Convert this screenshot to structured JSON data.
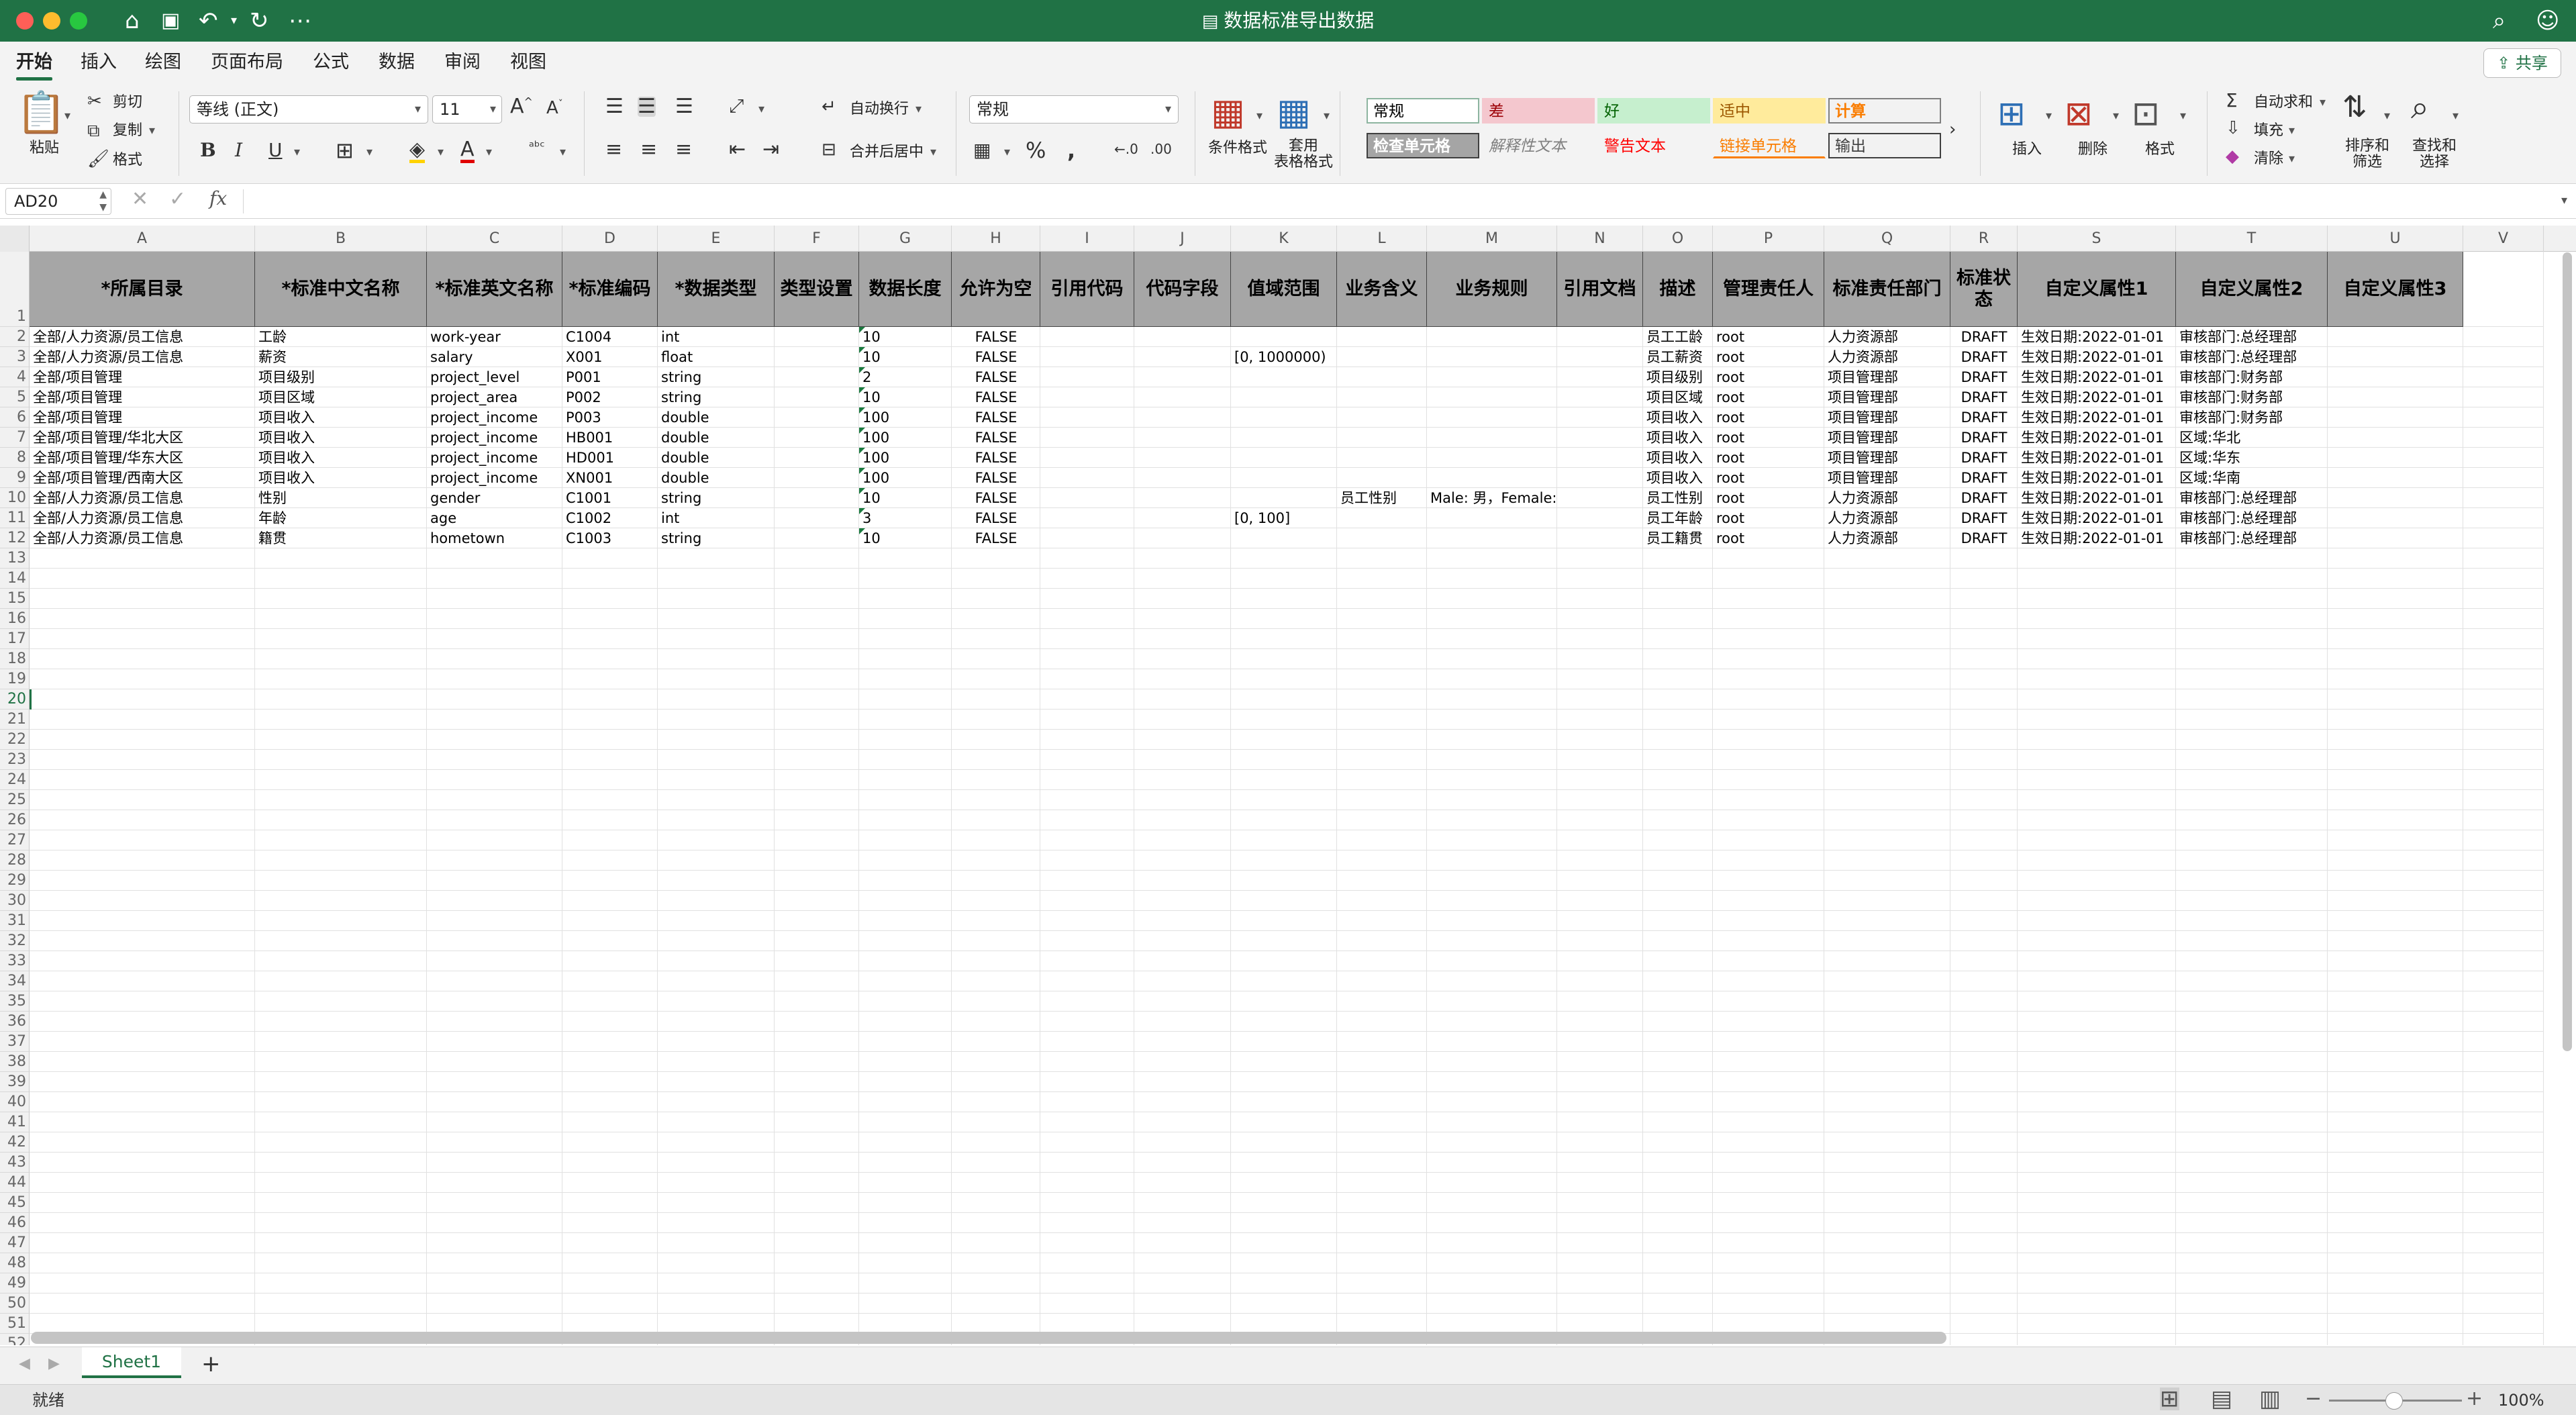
{
  "window": {
    "title": "数据标准导出数据",
    "title_icon": "document-icon"
  },
  "menu_tabs": [
    "开始",
    "插入",
    "绘图",
    "页面布局",
    "公式",
    "数据",
    "审阅",
    "视图"
  ],
  "share_label": "共享",
  "ribbon": {
    "paste": "粘贴",
    "cut": "剪切",
    "copy": "复制",
    "format_painter": "格式",
    "font_name": "等线 (正文)",
    "font_size": "11",
    "wrap_text": "自动换行",
    "merge_center": "合并后居中",
    "number_format": "常规",
    "conditional_format": "条件格式",
    "table_format": "套用\n表格格式",
    "styles": [
      {
        "label": "常规",
        "bg": "#ffffff",
        "fg": "#000000",
        "border": "#8db5a0"
      },
      {
        "label": "差",
        "bg": "#f4c7ce",
        "fg": "#9c0006",
        "border": "#f4c7ce"
      },
      {
        "label": "好",
        "bg": "#c6efce",
        "fg": "#006100",
        "border": "#c6efce"
      },
      {
        "label": "适中",
        "bg": "#ffeb9c",
        "fg": "#9c5700",
        "border": "#ffeb9c"
      },
      {
        "label": "计算",
        "bg": "#f2f2f2",
        "fg": "#fa7d00",
        "border": "#7f7f7f"
      },
      {
        "label": "检查单元格",
        "bg": "#a5a5a5",
        "fg": "#ffffff",
        "border": "#3f3f3f"
      },
      {
        "label": "解释性文本",
        "bg": "#f3f3f3",
        "fg": "#7f7f7f",
        "border": "#f3f3f3"
      },
      {
        "label": "警告文本",
        "bg": "#f3f3f3",
        "fg": "#ff0000",
        "border": "#f3f3f3"
      },
      {
        "label": "链接单元格",
        "bg": "#f3f3f3",
        "fg": "#fa7d00",
        "border": "#f3f3f3"
      },
      {
        "label": "输出",
        "bg": "#f2f2f2",
        "fg": "#3f3f3f",
        "border": "#3f3f3f"
      }
    ],
    "insert": "插入",
    "delete": "删除",
    "format": "格式",
    "autosum": "自动求和",
    "fill": "填充",
    "clear": "清除",
    "sort_filter": "排序和\n筛选",
    "find_select": "查找和\n选择"
  },
  "formula_bar": {
    "name_box": "AD20",
    "fx": "fx",
    "content": ""
  },
  "columns": [
    "A",
    "B",
    "C",
    "D",
    "E",
    "F",
    "G",
    "H",
    "I",
    "J",
    "K",
    "L",
    "M",
    "N",
    "O",
    "P",
    "Q",
    "R",
    "S",
    "T",
    "U",
    "V"
  ],
  "headers": [
    "*所属目录",
    "*标准中文名称",
    "*标准英文名称",
    "*标准编码",
    "*数据类型",
    "类型设置",
    "数据长度",
    "允许为空",
    "引用代码",
    "代码字段",
    "值域范围",
    "业务含义",
    "业务规则",
    "引用文档",
    "描述",
    "管理责任人",
    "标准责任部门",
    "标准状态",
    "自定义属性1",
    "自定义属性2",
    "自定义属性3"
  ],
  "rows": [
    [
      "全部/人力资源/员工信息",
      "工龄",
      "work-year",
      "C1004",
      "int",
      "",
      "10",
      "FALSE",
      "",
      "",
      "",
      "",
      "",
      "",
      "员工工龄",
      "root",
      "人力资源部",
      "DRAFT",
      "生效日期:2022-01-01",
      "审核部门:总经理部",
      ""
    ],
    [
      "全部/人力资源/员工信息",
      "薪资",
      "salary",
      "X001",
      "float",
      "",
      "10",
      "FALSE",
      "",
      "",
      "[0, 1000000)",
      "",
      "",
      "",
      "员工薪资",
      "root",
      "人力资源部",
      "DRAFT",
      "生效日期:2022-01-01",
      "审核部门:总经理部",
      ""
    ],
    [
      "全部/项目管理",
      "项目级别",
      "project_level",
      "P001",
      "string",
      "",
      "2",
      "FALSE",
      "",
      "",
      "",
      "",
      "",
      "",
      "项目级别",
      "root",
      "项目管理部",
      "DRAFT",
      "生效日期:2022-01-01",
      "审核部门:财务部",
      ""
    ],
    [
      "全部/项目管理",
      "项目区域",
      "project_area",
      "P002",
      "string",
      "",
      "10",
      "FALSE",
      "",
      "",
      "",
      "",
      "",
      "",
      "项目区域",
      "root",
      "项目管理部",
      "DRAFT",
      "生效日期:2022-01-01",
      "审核部门:财务部",
      ""
    ],
    [
      "全部/项目管理",
      "项目收入",
      "project_income",
      "P003",
      "double",
      "",
      "100",
      "FALSE",
      "",
      "",
      "",
      "",
      "",
      "",
      "项目收入",
      "root",
      "项目管理部",
      "DRAFT",
      "生效日期:2022-01-01",
      "审核部门:财务部",
      ""
    ],
    [
      "全部/项目管理/华北大区",
      "项目收入",
      "project_income",
      "HB001",
      "double",
      "",
      "100",
      "FALSE",
      "",
      "",
      "",
      "",
      "",
      "",
      "项目收入",
      "root",
      "项目管理部",
      "DRAFT",
      "生效日期:2022-01-01",
      "区域:华北",
      ""
    ],
    [
      "全部/项目管理/华东大区",
      "项目收入",
      "project_income",
      "HD001",
      "double",
      "",
      "100",
      "FALSE",
      "",
      "",
      "",
      "",
      "",
      "",
      "项目收入",
      "root",
      "项目管理部",
      "DRAFT",
      "生效日期:2022-01-01",
      "区域:华东",
      ""
    ],
    [
      "全部/项目管理/西南大区",
      "项目收入",
      "project_income",
      "XN001",
      "double",
      "",
      "100",
      "FALSE",
      "",
      "",
      "",
      "",
      "",
      "",
      "项目收入",
      "root",
      "项目管理部",
      "DRAFT",
      "生效日期:2022-01-01",
      "区域:华南",
      ""
    ],
    [
      "全部/人力资源/员工信息",
      "性别",
      "gender",
      "C1001",
      "string",
      "",
      "10",
      "FALSE",
      "",
      "",
      "",
      "员工性别",
      "Male: 男，Female: 女",
      "",
      "员工性别",
      "root",
      "人力资源部",
      "DRAFT",
      "生效日期:2022-01-01",
      "审核部门:总经理部",
      ""
    ],
    [
      "全部/人力资源/员工信息",
      "年龄",
      "age",
      "C1002",
      "int",
      "",
      "3",
      "FALSE",
      "",
      "",
      "[0, 100]",
      "",
      "",
      "",
      "员工年龄",
      "root",
      "人力资源部",
      "DRAFT",
      "生效日期:2022-01-01",
      "审核部门:总经理部",
      ""
    ],
    [
      "全部/人力资源/员工信息",
      "籍贯",
      "hometown",
      "C1003",
      "string",
      "",
      "10",
      "FALSE",
      "",
      "",
      "",
      "",
      "",
      "",
      "员工籍贯",
      "root",
      "人力资源部",
      "DRAFT",
      "生效日期:2022-01-01",
      "审核部门:总经理部",
      ""
    ]
  ],
  "row_count": 52,
  "active_row": 20,
  "sheet_tab": "Sheet1",
  "add_sheet": "+",
  "status": {
    "ready": "就绪",
    "zoom": "100%"
  },
  "theme": {
    "accent": "#207245",
    "header_fill": "#a6a6a6"
  }
}
